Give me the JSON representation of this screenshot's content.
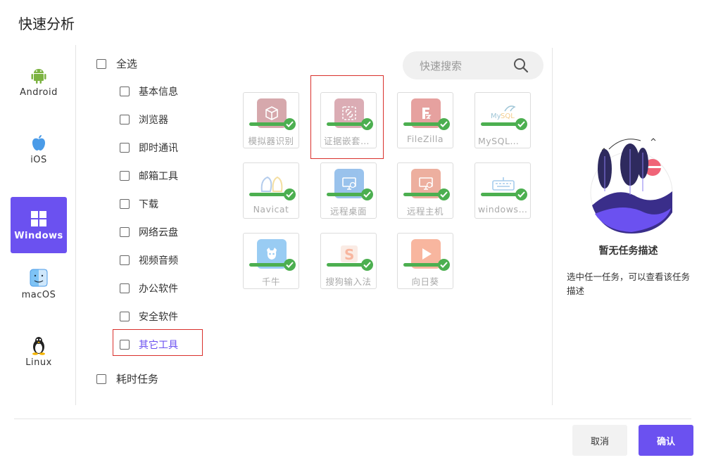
{
  "dialog": {
    "title": "快速分析"
  },
  "os_list": [
    {
      "label": "Android",
      "icon": "android-icon"
    },
    {
      "label": "iOS",
      "icon": "apple-icon"
    },
    {
      "label": "Windows",
      "icon": "windows-icon",
      "active": true
    },
    {
      "label": "macOS",
      "icon": "finder-icon"
    },
    {
      "label": "Linux",
      "icon": "tux-icon"
    }
  ],
  "categories": {
    "select_all": "全选",
    "items": [
      "基本信息",
      "浏览器",
      "即时通讯",
      "邮箱工具",
      "下载",
      "网络云盘",
      "视频音频",
      "办公软件",
      "安全软件",
      "其它工具"
    ],
    "selected_index": 9,
    "time_task": "耗时任务"
  },
  "search": {
    "placeholder": "快速搜索"
  },
  "tools": [
    {
      "name": "模拟器识别",
      "color": "#a6404a"
    },
    {
      "name": "证据嵌套识...",
      "color": "#b04a5a"
    },
    {
      "name": "FileZilla",
      "color": "#c9302c"
    },
    {
      "name": "MySQL解析",
      "color": "#2a7fa6"
    },
    {
      "name": "Navicat",
      "color": "#5a8fd6"
    },
    {
      "name": "远程桌面",
      "color": "#1f7ad6"
    },
    {
      "name": "远程主机",
      "color": "#d9502c"
    },
    {
      "name": "windows...",
      "color": "#3a8fd6"
    },
    {
      "name": "千牛",
      "color": "#1f8fe6"
    },
    {
      "name": "搜狗输入法",
      "color": "#f0602c"
    },
    {
      "name": "向日葵",
      "color": "#f0602c"
    }
  ],
  "detail": {
    "empty_title": "暂无任务描述",
    "empty_desc": "选中任一任务，可以查看该任务描述"
  },
  "footer": {
    "cancel_label": "取消",
    "confirm_label": "确认"
  },
  "colors": {
    "accent": "#6b51f0",
    "success": "#4caf50",
    "highlight_border": "#d9302c"
  }
}
